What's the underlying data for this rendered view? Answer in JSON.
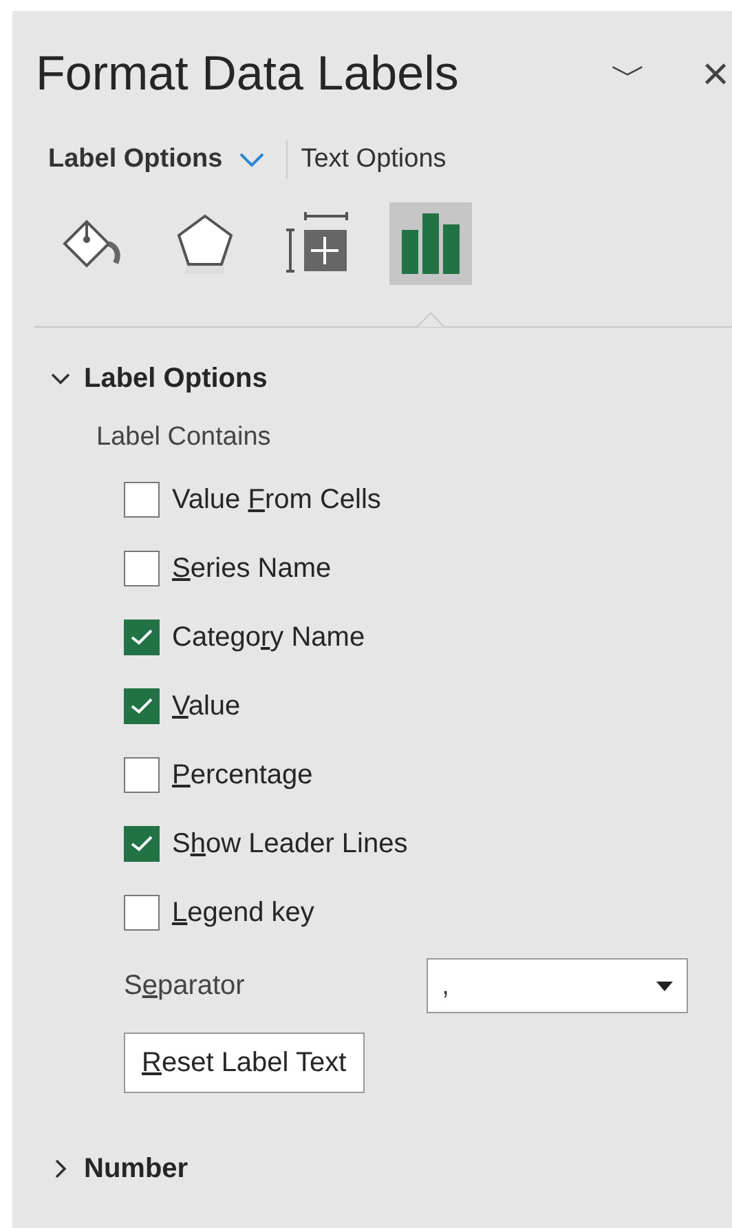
{
  "pane": {
    "title": "Format Data Labels",
    "dropdown_glyph": "﹀",
    "close_glyph": "×"
  },
  "tabs": [
    {
      "label": "Label Options",
      "selected": true
    },
    {
      "label": "Text Options",
      "selected": false
    }
  ],
  "icon_tabs": [
    {
      "kind": "fill",
      "selected": false
    },
    {
      "kind": "effects",
      "selected": false
    },
    {
      "kind": "size",
      "selected": false
    },
    {
      "kind": "options",
      "selected": true
    }
  ],
  "sections": [
    {
      "title": "Label Options",
      "expanded": true,
      "group_label": "Label Contains",
      "options": [
        {
          "pre": "Value ",
          "key": "F",
          "post": "rom Cells",
          "checked": false
        },
        {
          "key": "S",
          "post": "eries Name",
          "checked": false
        },
        {
          "pre": "Catego",
          "key": "r",
          "post": "y Name",
          "checked": true
        },
        {
          "key": "V",
          "post": "alue",
          "checked": true
        },
        {
          "key": "P",
          "post": "ercentage",
          "checked": false
        },
        {
          "pre": "S",
          "key": "h",
          "post": "ow Leader Lines",
          "checked": true
        },
        {
          "key": "L",
          "post": "egend key",
          "checked": false
        }
      ],
      "separator": {
        "pre": "S",
        "key": "e",
        "post": "parator",
        "value": ","
      },
      "button": {
        "key": "R",
        "post": "eset Label Text"
      }
    },
    {
      "title": "Number",
      "expanded": false
    }
  ]
}
